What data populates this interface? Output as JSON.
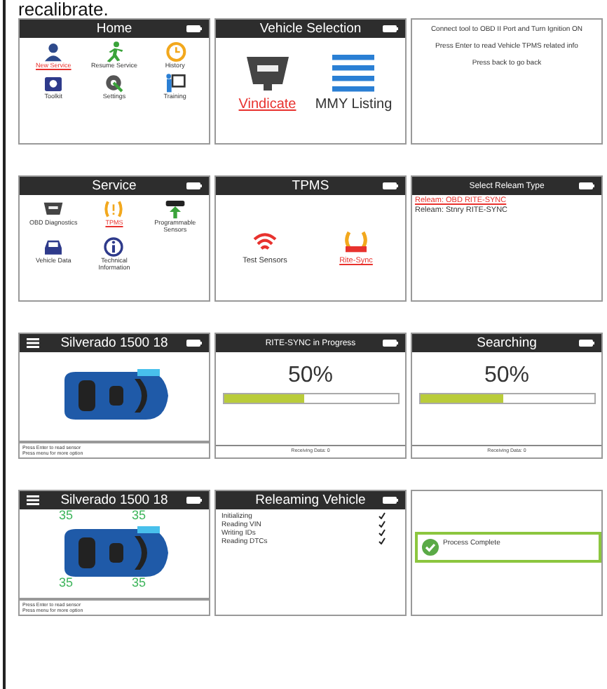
{
  "heading": "recalibrate.",
  "rows": [
    {
      "panels": [
        {
          "kind": "menu",
          "title": "Home",
          "items": [
            {
              "label": "New Service",
              "selected": true
            },
            {
              "label": "Resume Service",
              "selected": false
            },
            {
              "label": "History",
              "selected": false
            },
            {
              "label": "Toolkit",
              "selected": false
            },
            {
              "label": "Settings",
              "selected": false
            },
            {
              "label": "Training",
              "selected": false
            }
          ]
        },
        {
          "kind": "menu",
          "title": "Vehicle Selection",
          "items": [
            {
              "label": "Vindicate",
              "selected": true
            },
            {
              "label": "MMY Listing",
              "selected": false
            }
          ]
        },
        {
          "kind": "text",
          "lines": [
            "Connect tool to OBD II Port and Turn Ignition ON",
            "Press Enter to read Vehicle TPMS related info",
            "Press back to go back"
          ]
        }
      ]
    },
    {
      "panels": [
        {
          "kind": "menu",
          "title": "Service",
          "items": [
            {
              "label": "OBD Diagnostics",
              "selected": false
            },
            {
              "label": "TPMS",
              "selected": true
            },
            {
              "label": "Programmable Sensors",
              "selected": false
            },
            {
              "label": "Vehicle Data",
              "selected": false
            },
            {
              "label": "Technical Information",
              "selected": false
            }
          ]
        },
        {
          "kind": "menu",
          "title": "TPMS",
          "items": [
            {
              "label": "Test Sensors",
              "selected": false
            },
            {
              "label": "Rite-Sync",
              "selected": true
            }
          ]
        },
        {
          "kind": "list",
          "title": "Select Releam Type",
          "items": [
            {
              "label": "Releam: OBD RITE-SYNC",
              "selected": true
            },
            {
              "label": "Releam: Stnry RITE-SYNC",
              "selected": false
            }
          ]
        }
      ]
    },
    {
      "panels": [
        {
          "kind": "vehicle",
          "title": "Silverado 1500 18",
          "footer": [
            "Press Enter to read sensor",
            "Press menu for more option"
          ]
        },
        {
          "kind": "progress",
          "title": "RITE-SYNC in Progress",
          "percent": "50%",
          "level": 0.46,
          "footer": "Receiving Data: 0"
        },
        {
          "kind": "progress",
          "title": "Searching",
          "percent": "50%",
          "level": 0.48,
          "footer": "Receiving Data: 0"
        }
      ]
    },
    {
      "panels": [
        {
          "kind": "vehicle",
          "title": "Silverado 1500 18",
          "pressures": [
            "35",
            "35",
            "35",
            "35"
          ],
          "footer": [
            "Press Enter to read sensor",
            "Press menu for more option"
          ]
        },
        {
          "kind": "checklist",
          "title": "Releaming Vehicle",
          "items": [
            {
              "label": "Initializing",
              "checked": true
            },
            {
              "label": "Reading VIN",
              "checked": true
            },
            {
              "label": "Writing IDs",
              "checked": true
            },
            {
              "label": "Reading DTCs",
              "checked": true
            }
          ]
        },
        {
          "kind": "complete",
          "message": "Process Complete"
        }
      ]
    }
  ]
}
